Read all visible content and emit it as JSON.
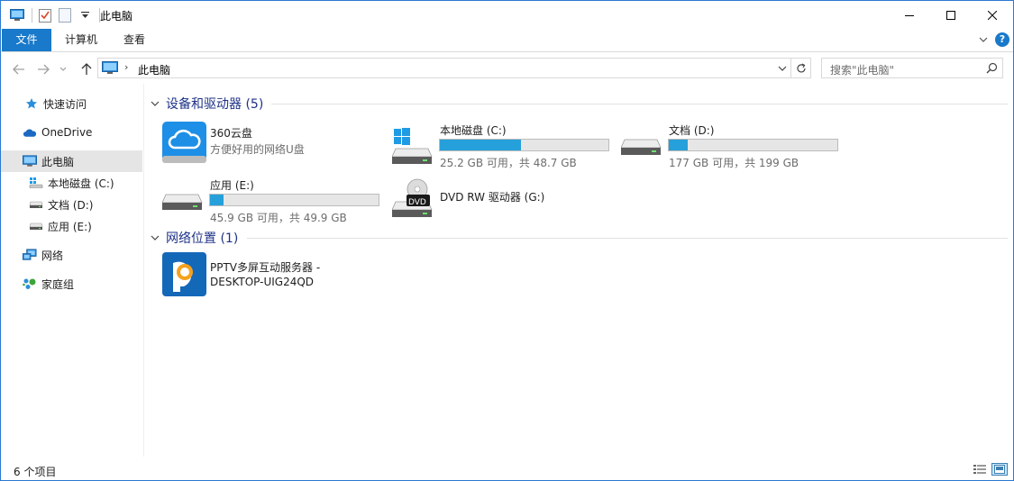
{
  "window": {
    "title": "此电脑",
    "colors": {
      "accent": "#1979ca",
      "bar_fill": "#26a0da",
      "group_header": "#1e3287"
    }
  },
  "ribbon": {
    "tabs": [
      {
        "label": "文件"
      },
      {
        "label": "计算机"
      },
      {
        "label": "查看"
      }
    ]
  },
  "address": {
    "path": "此电脑",
    "search_placeholder": "搜索\"此电脑\""
  },
  "sidebar": {
    "items": [
      {
        "label": "快速访问",
        "icon": "star-icon"
      },
      {
        "label": "OneDrive",
        "icon": "cloud-icon"
      },
      {
        "label": "此电脑",
        "icon": "computer-icon",
        "selected": true
      },
      {
        "label": "本地磁盘 (C:)",
        "icon": "windows-drive-icon"
      },
      {
        "label": "文档 (D:)",
        "icon": "drive-icon"
      },
      {
        "label": "应用 (E:)",
        "icon": "drive-icon"
      },
      {
        "label": "网络",
        "icon": "network-icon"
      },
      {
        "label": "家庭组",
        "icon": "homegroup-icon"
      }
    ]
  },
  "groups": {
    "devices": {
      "title": "设备和驱动器 (5)",
      "items": [
        {
          "name": "360云盘",
          "subtitle": "方便好用的网络U盘",
          "icon": "cloud360-icon"
        },
        {
          "name": "本地磁盘 (C:)",
          "info": "25.2 GB 可用，共 48.7 GB",
          "used_fraction": 0.48,
          "icon": "windows-drive-icon"
        },
        {
          "name": "文档 (D:)",
          "info": "177 GB 可用，共 199 GB",
          "used_fraction": 0.11,
          "icon": "drive-icon"
        },
        {
          "name": "应用 (E:)",
          "info": "45.9 GB 可用，共 49.9 GB",
          "used_fraction": 0.08,
          "icon": "drive-icon"
        },
        {
          "name": "DVD RW 驱动器 (G:)",
          "icon": "dvd-drive-icon",
          "icon_text": "DVD"
        }
      ]
    },
    "network": {
      "title": "网络位置 (1)",
      "items": [
        {
          "name_line1": "PPTV多屏互动服务器 -",
          "name_line2": "DESKTOP-UIG24QD",
          "icon": "pptv-icon"
        }
      ]
    }
  },
  "status": {
    "count": "6 个项目"
  }
}
